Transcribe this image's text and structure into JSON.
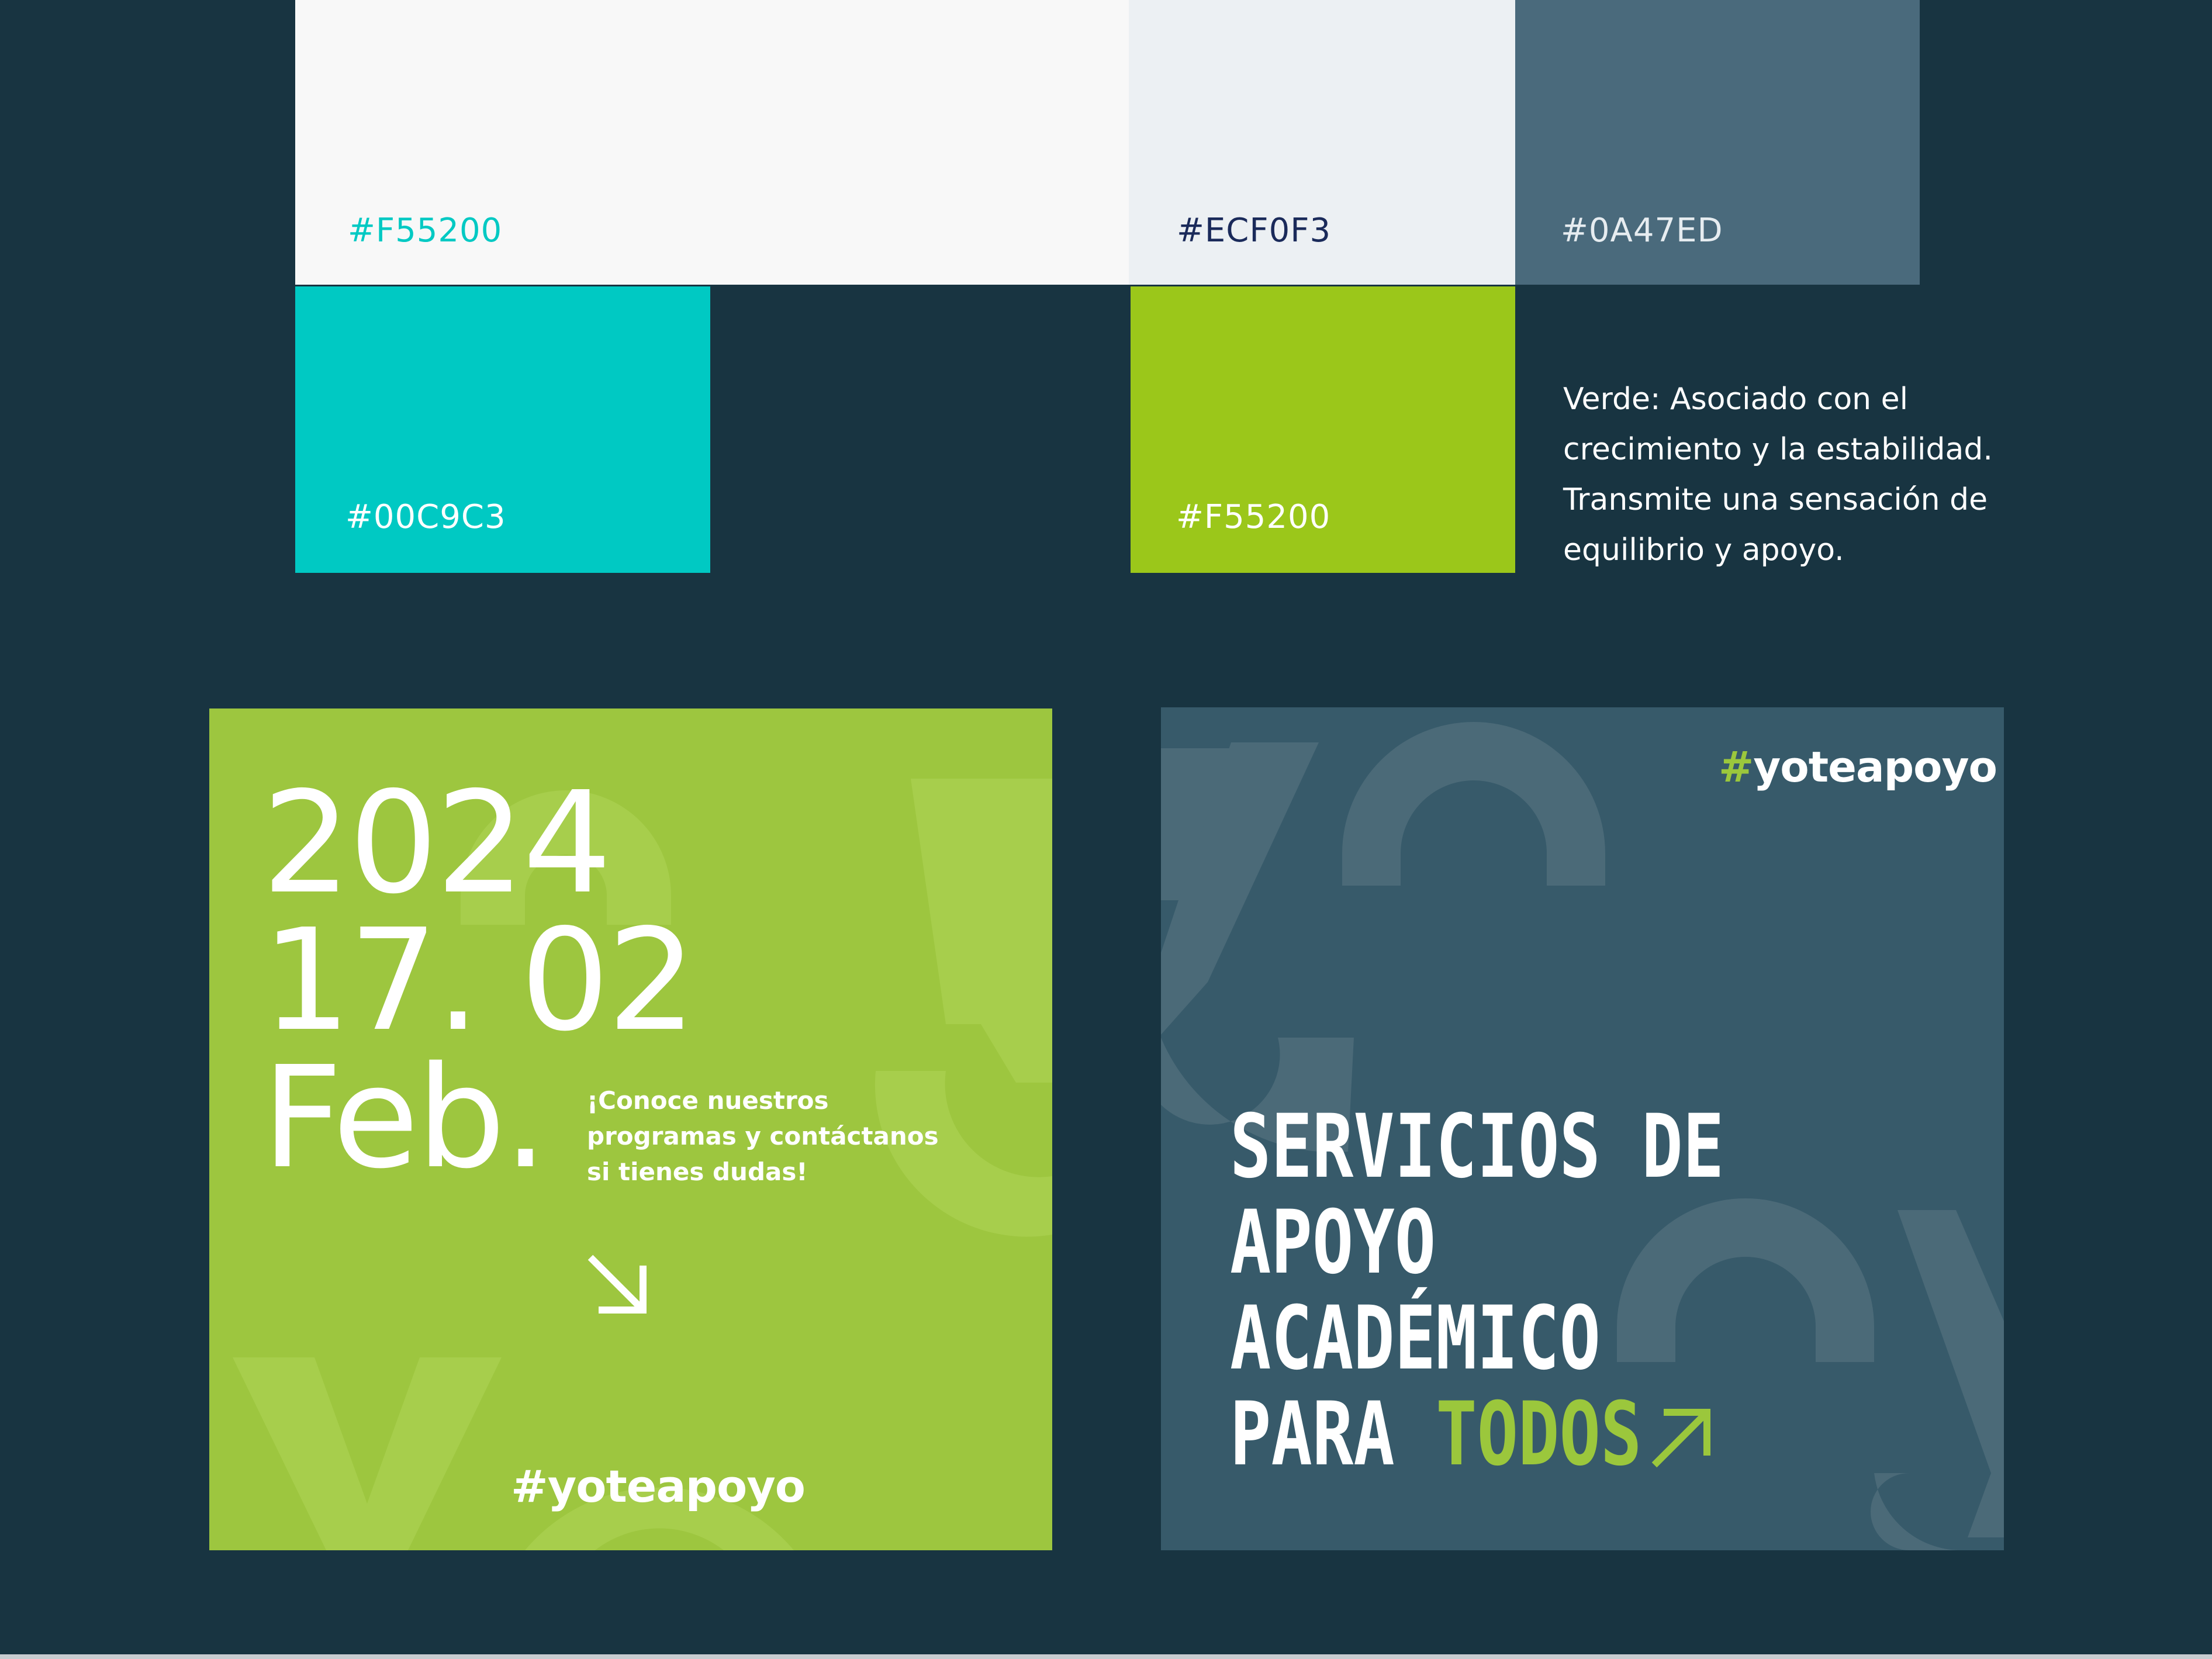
{
  "palette": {
    "swatch_white": {
      "hex_label": "#F55200",
      "fill": "#F8F8F8",
      "label_color": "#00C9C3"
    },
    "swatch_light": {
      "hex_label": "#ECF0F3",
      "fill": "#ECF0F3",
      "label_color": "#1A2A5A"
    },
    "swatch_slate": {
      "hex_label": "#0A47ED",
      "fill": "#4A6A7C",
      "label_color": "#E6ECF0"
    },
    "swatch_teal": {
      "hex_label": "#00C9C3",
      "fill": "#00C9C3",
      "label_color": "#FFFFFF"
    },
    "swatch_green": {
      "hex_label": "#F55200",
      "fill": "#9BC71A",
      "label_color": "#FFFFFF"
    },
    "description": "Verde: Asociado con el crecimiento y la estabilidad. Transmite una sensación de equilibrio y apoyo."
  },
  "card_event": {
    "background": "#9DC63F",
    "year": "2024",
    "date": "17. 02",
    "month": "Feb.",
    "message": "¡Conoce nuestros programas y contáctanos si tienes dudas!",
    "arrow_icon": "arrow-down-right-icon",
    "hashtag_symbol": "#",
    "hashtag_text": "yoteapoyo"
  },
  "card_services": {
    "background": "#375A6A",
    "hashtag_symbol": "#",
    "hashtag_text": "yoteapoyo",
    "headline_line1": "SERVICIOS DE",
    "headline_line2": "APOYO",
    "headline_line3": "ACADÉMICO",
    "headline_line4_a": "PARA",
    "headline_line4_b": "TODOS",
    "arrow_icon": "arrow-up-right-icon"
  }
}
